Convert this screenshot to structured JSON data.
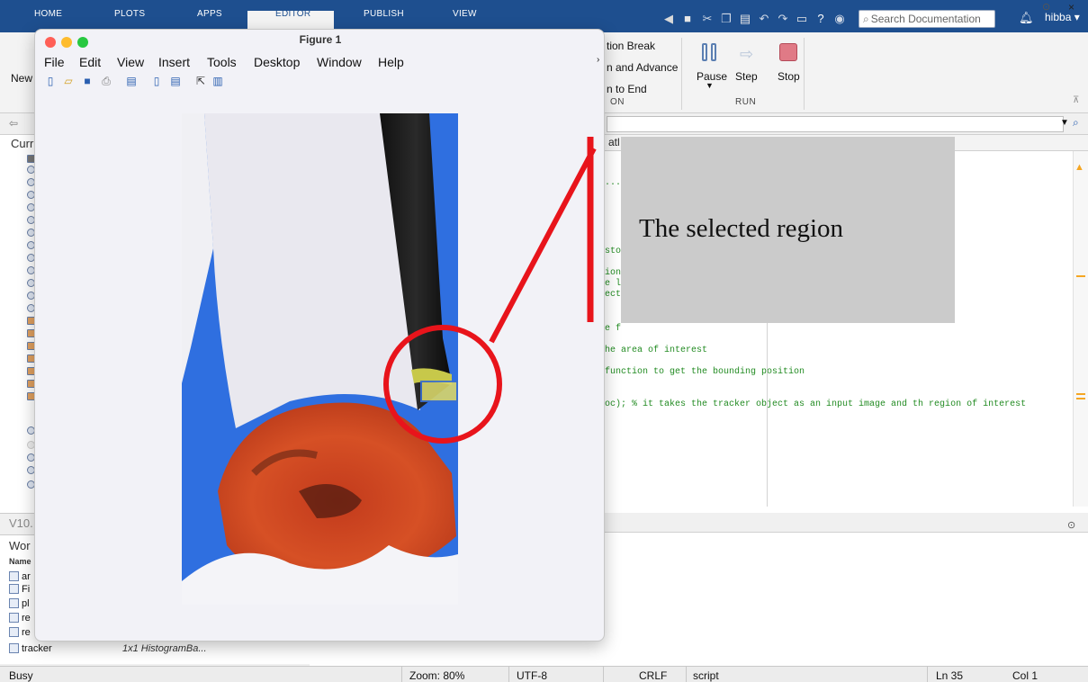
{
  "tabs": [
    "HOME",
    "PLOTS",
    "APPS",
    "EDITOR",
    "PUBLISH",
    "VIEW"
  ],
  "search": {
    "placeholder": "Search Documentation"
  },
  "user": {
    "name": "hibba ▾"
  },
  "ribbon": {
    "new_label": "New",
    "breakpoint_items": [
      "tion Break",
      "n and Advance",
      "n to End"
    ],
    "section_partial": "ON",
    "pause_label": "Pause",
    "step_label": "Step",
    "stop_label": "Stop",
    "run_section": "RUN"
  },
  "left": {
    "header": "Curr",
    "versions_label": "V10.",
    "workspace_header": "Wor",
    "workspace_col": "Name",
    "workspace_rows": [
      {
        "name": "ar",
        "value": ""
      },
      {
        "name": "Fi",
        "value": ""
      },
      {
        "name": "pl",
        "value": ""
      },
      {
        "name": "re",
        "value": ""
      },
      {
        "name": "re",
        "value": ""
      },
      {
        "name": "tracker",
        "value": "1x1 HistogramBa..."
      }
    ]
  },
  "editor": {
    "tab_partial": "atl",
    "lines": [
      {
        "text": "..."
      },
      {
        "text": "sto"
      },
      {
        "text": "ion"
      },
      {
        "text": "e l"
      },
      {
        "text": "ect"
      },
      {
        "text": "e f"
      },
      {
        "text": "he area of interest"
      },
      {
        "text": " function to get the bounding position"
      },
      {
        "text": "oc); % it takes the tracker object as an input image and th region of interest"
      }
    ]
  },
  "figure": {
    "title": "Figure 1",
    "menu": [
      "File",
      "Edit",
      "View",
      "Insert",
      "Tools",
      "Desktop",
      "Window",
      "Help"
    ]
  },
  "annotation": {
    "callout_text": "The selected region",
    "color": "#e8141b"
  },
  "status": {
    "state": "Busy",
    "zoom": "Zoom: 80%",
    "encoding": "UTF-8",
    "eol": "CRLF",
    "type": "script",
    "line": "Ln  35",
    "col": "Col  1"
  },
  "colors": {
    "tabbar": "#1e4f8f",
    "ribbon": "#f3f3f3",
    "callout_bg": "#cbcbcb"
  }
}
